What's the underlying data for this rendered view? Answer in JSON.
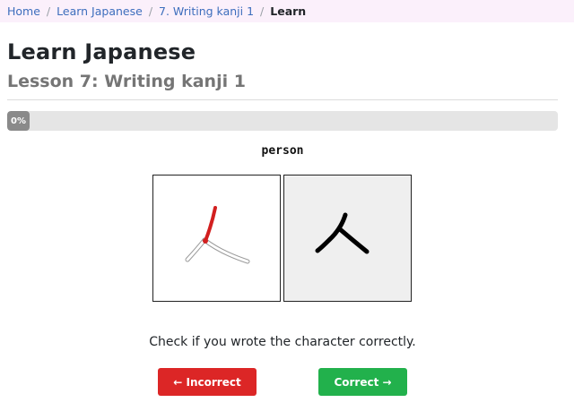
{
  "breadcrumb": {
    "items": [
      "Home",
      "Learn Japanese",
      "7. Writing kanji 1"
    ],
    "current": "Learn",
    "separator": "/"
  },
  "header": {
    "title": "Learn Japanese",
    "subtitle": "Lesson 7: Writing kanji 1"
  },
  "progress": {
    "label": "0%",
    "value": 0
  },
  "exercise": {
    "word": "person",
    "answer_character": "人",
    "instruction": "Check if you wrote the character correctly."
  },
  "buttons": {
    "incorrect_label": "← Incorrect",
    "correct_label": "Correct →"
  },
  "colors": {
    "breadcrumb_bg": "#fbf0fb",
    "link": "#3d6ebd",
    "subtitle": "#757575",
    "stroke_highlight": "#d21f1f",
    "incorrect": "#dc2626",
    "correct": "#22b14c",
    "progress_track": "#e5e5e5",
    "progress_fill": "#8a8a8a"
  }
}
